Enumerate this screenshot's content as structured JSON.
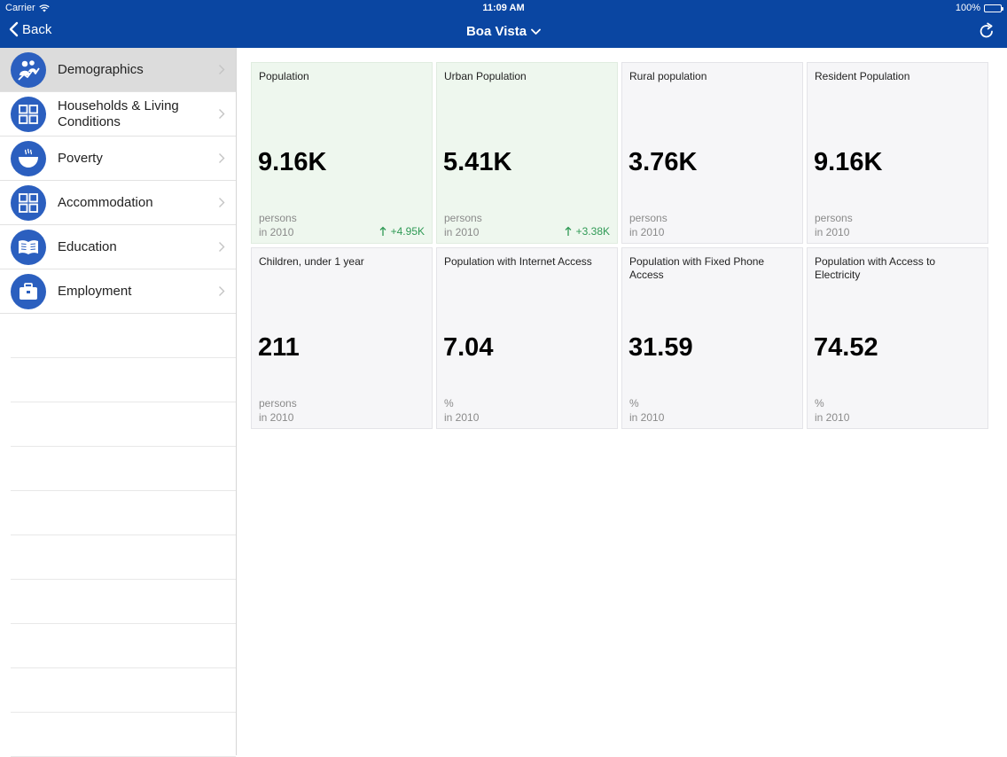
{
  "status_bar": {
    "carrier": "Carrier",
    "time": "11:09 AM",
    "battery": "100%"
  },
  "nav": {
    "back_label": "Back",
    "title": "Boa Vista"
  },
  "colors": {
    "nav_background": "#0a46a2",
    "icon_background": "#2b5fbf",
    "active_row": "#dcdcdc",
    "card_highlight": "#eef7ee",
    "delta_positive": "#2f9a55"
  },
  "sidebar": {
    "items": [
      {
        "label": "Demographics",
        "icon": "demographics-icon",
        "active": true
      },
      {
        "label": "Households & Living Conditions",
        "icon": "grid-icon",
        "active": false
      },
      {
        "label": "Poverty",
        "icon": "bowl-icon",
        "active": false
      },
      {
        "label": "Accommodation",
        "icon": "grid-icon",
        "active": false
      },
      {
        "label": "Education",
        "icon": "book-icon",
        "active": false
      },
      {
        "label": "Employment",
        "icon": "briefcase-icon",
        "active": false
      }
    ]
  },
  "cards": [
    {
      "title": "Population",
      "value": "9.16K",
      "unit": "persons",
      "year": "in 2010",
      "delta": "+4.95K",
      "highlight": true
    },
    {
      "title": "Urban Population",
      "value": "5.41K",
      "unit": "persons",
      "year": "in 2010",
      "delta": "+3.38K",
      "highlight": true
    },
    {
      "title": "Rural population",
      "value": "3.76K",
      "unit": "persons",
      "year": "in 2010"
    },
    {
      "title": "Resident Population",
      "value": "9.16K",
      "unit": "persons",
      "year": "in 2010"
    },
    {
      "title": "Children, under 1 year",
      "value": "211",
      "unit": "persons",
      "year": "in 2010"
    },
    {
      "title": "Population with Internet Access",
      "value": "7.04",
      "unit": "%",
      "year": "in 2010"
    },
    {
      "title": "Population with Fixed Phone Access",
      "value": "31.59",
      "unit": "%",
      "year": "in 2010"
    },
    {
      "title": "Population with Access to Electricity",
      "value": "74.52",
      "unit": "%",
      "year": "in 2010"
    }
  ]
}
